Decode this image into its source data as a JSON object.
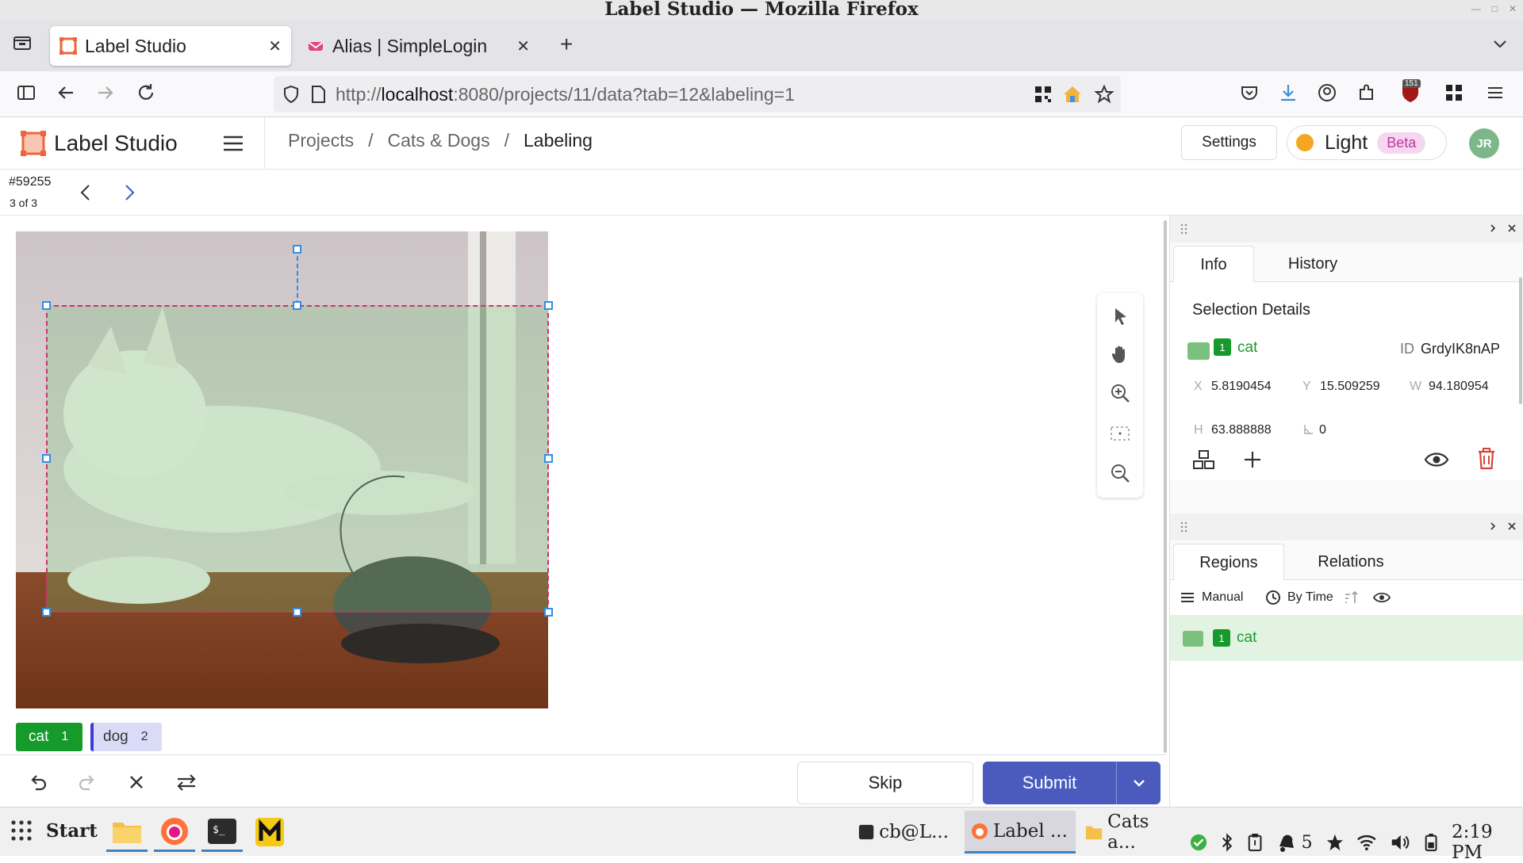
{
  "window": {
    "title": "Label Studio — Mozilla Firefox"
  },
  "browser": {
    "tabs": [
      {
        "label": "Label Studio",
        "active": true
      },
      {
        "label": "Alias | SimpleLogin",
        "active": false
      }
    ],
    "url_prefix": "http://",
    "url_host": "localhost",
    "url_rest": ":8080/projects/11/data?tab=12&labeling=1",
    "extension_badge": "151"
  },
  "app": {
    "name": "Label Studio",
    "breadcrumb": [
      "Projects",
      "Cats & Dogs",
      "Labeling"
    ],
    "breadcrumb_sep": "/",
    "settings_label": "Settings",
    "theme_label": "Light",
    "theme_badge": "Beta",
    "avatar_initials": "JR",
    "accent_color": "#4a5bbd"
  },
  "task": {
    "id": "#59255",
    "position": "3 of 3"
  },
  "labels": [
    {
      "name": "cat",
      "hotkey": "1",
      "color": "#179a2c"
    },
    {
      "name": "dog",
      "hotkey": "2",
      "color": "#c9cdf5"
    }
  ],
  "actions": {
    "skip": "Skip",
    "submit": "Submit"
  },
  "info_panel": {
    "tabs": [
      "Info",
      "History"
    ],
    "heading": "Selection Details",
    "region": {
      "index": "1",
      "label": "cat",
      "id_label": "ID",
      "id": "GrdyIK8nAP",
      "x_label": "X",
      "x": "5.8190454",
      "y_label": "Y",
      "y": "15.509259",
      "w_label": "W",
      "w": "94.180954",
      "h_label": "H",
      "h": "63.888888",
      "angle": "0"
    }
  },
  "regions_panel": {
    "tabs": [
      "Regions",
      "Relations"
    ],
    "sort_manual": "Manual",
    "sort_time": "By Time",
    "items": [
      {
        "index": "1",
        "label": "cat"
      }
    ]
  },
  "taskbar": {
    "start": "Start",
    "windows": [
      {
        "label": "cb@L...",
        "active": false
      },
      {
        "label": "Label ...",
        "active": true
      },
      {
        "label": "Cats a...",
        "active": false
      }
    ],
    "notify_count": "5",
    "clock": "2:19 PM"
  }
}
